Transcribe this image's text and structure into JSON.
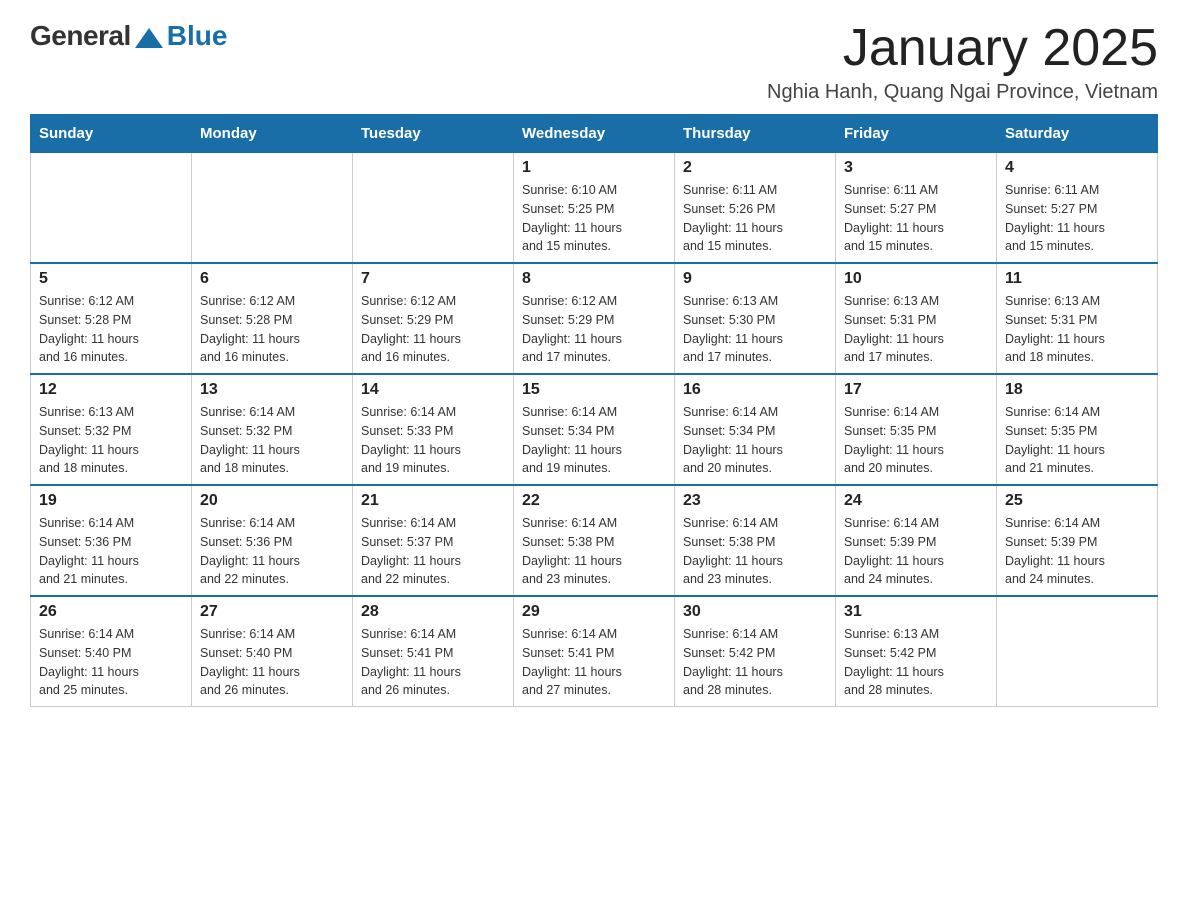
{
  "header": {
    "logo_general": "General",
    "logo_blue": "Blue",
    "month_title": "January 2025",
    "location": "Nghia Hanh, Quang Ngai Province, Vietnam"
  },
  "days_of_week": [
    "Sunday",
    "Monday",
    "Tuesday",
    "Wednesday",
    "Thursday",
    "Friday",
    "Saturday"
  ],
  "weeks": [
    [
      {
        "day": "",
        "info": ""
      },
      {
        "day": "",
        "info": ""
      },
      {
        "day": "",
        "info": ""
      },
      {
        "day": "1",
        "info": "Sunrise: 6:10 AM\nSunset: 5:25 PM\nDaylight: 11 hours\nand 15 minutes."
      },
      {
        "day": "2",
        "info": "Sunrise: 6:11 AM\nSunset: 5:26 PM\nDaylight: 11 hours\nand 15 minutes."
      },
      {
        "day": "3",
        "info": "Sunrise: 6:11 AM\nSunset: 5:27 PM\nDaylight: 11 hours\nand 15 minutes."
      },
      {
        "day": "4",
        "info": "Sunrise: 6:11 AM\nSunset: 5:27 PM\nDaylight: 11 hours\nand 15 minutes."
      }
    ],
    [
      {
        "day": "5",
        "info": "Sunrise: 6:12 AM\nSunset: 5:28 PM\nDaylight: 11 hours\nand 16 minutes."
      },
      {
        "day": "6",
        "info": "Sunrise: 6:12 AM\nSunset: 5:28 PM\nDaylight: 11 hours\nand 16 minutes."
      },
      {
        "day": "7",
        "info": "Sunrise: 6:12 AM\nSunset: 5:29 PM\nDaylight: 11 hours\nand 16 minutes."
      },
      {
        "day": "8",
        "info": "Sunrise: 6:12 AM\nSunset: 5:29 PM\nDaylight: 11 hours\nand 17 minutes."
      },
      {
        "day": "9",
        "info": "Sunrise: 6:13 AM\nSunset: 5:30 PM\nDaylight: 11 hours\nand 17 minutes."
      },
      {
        "day": "10",
        "info": "Sunrise: 6:13 AM\nSunset: 5:31 PM\nDaylight: 11 hours\nand 17 minutes."
      },
      {
        "day": "11",
        "info": "Sunrise: 6:13 AM\nSunset: 5:31 PM\nDaylight: 11 hours\nand 18 minutes."
      }
    ],
    [
      {
        "day": "12",
        "info": "Sunrise: 6:13 AM\nSunset: 5:32 PM\nDaylight: 11 hours\nand 18 minutes."
      },
      {
        "day": "13",
        "info": "Sunrise: 6:14 AM\nSunset: 5:32 PM\nDaylight: 11 hours\nand 18 minutes."
      },
      {
        "day": "14",
        "info": "Sunrise: 6:14 AM\nSunset: 5:33 PM\nDaylight: 11 hours\nand 19 minutes."
      },
      {
        "day": "15",
        "info": "Sunrise: 6:14 AM\nSunset: 5:34 PM\nDaylight: 11 hours\nand 19 minutes."
      },
      {
        "day": "16",
        "info": "Sunrise: 6:14 AM\nSunset: 5:34 PM\nDaylight: 11 hours\nand 20 minutes."
      },
      {
        "day": "17",
        "info": "Sunrise: 6:14 AM\nSunset: 5:35 PM\nDaylight: 11 hours\nand 20 minutes."
      },
      {
        "day": "18",
        "info": "Sunrise: 6:14 AM\nSunset: 5:35 PM\nDaylight: 11 hours\nand 21 minutes."
      }
    ],
    [
      {
        "day": "19",
        "info": "Sunrise: 6:14 AM\nSunset: 5:36 PM\nDaylight: 11 hours\nand 21 minutes."
      },
      {
        "day": "20",
        "info": "Sunrise: 6:14 AM\nSunset: 5:36 PM\nDaylight: 11 hours\nand 22 minutes."
      },
      {
        "day": "21",
        "info": "Sunrise: 6:14 AM\nSunset: 5:37 PM\nDaylight: 11 hours\nand 22 minutes."
      },
      {
        "day": "22",
        "info": "Sunrise: 6:14 AM\nSunset: 5:38 PM\nDaylight: 11 hours\nand 23 minutes."
      },
      {
        "day": "23",
        "info": "Sunrise: 6:14 AM\nSunset: 5:38 PM\nDaylight: 11 hours\nand 23 minutes."
      },
      {
        "day": "24",
        "info": "Sunrise: 6:14 AM\nSunset: 5:39 PM\nDaylight: 11 hours\nand 24 minutes."
      },
      {
        "day": "25",
        "info": "Sunrise: 6:14 AM\nSunset: 5:39 PM\nDaylight: 11 hours\nand 24 minutes."
      }
    ],
    [
      {
        "day": "26",
        "info": "Sunrise: 6:14 AM\nSunset: 5:40 PM\nDaylight: 11 hours\nand 25 minutes."
      },
      {
        "day": "27",
        "info": "Sunrise: 6:14 AM\nSunset: 5:40 PM\nDaylight: 11 hours\nand 26 minutes."
      },
      {
        "day": "28",
        "info": "Sunrise: 6:14 AM\nSunset: 5:41 PM\nDaylight: 11 hours\nand 26 minutes."
      },
      {
        "day": "29",
        "info": "Sunrise: 6:14 AM\nSunset: 5:41 PM\nDaylight: 11 hours\nand 27 minutes."
      },
      {
        "day": "30",
        "info": "Sunrise: 6:14 AM\nSunset: 5:42 PM\nDaylight: 11 hours\nand 28 minutes."
      },
      {
        "day": "31",
        "info": "Sunrise: 6:13 AM\nSunset: 5:42 PM\nDaylight: 11 hours\nand 28 minutes."
      },
      {
        "day": "",
        "info": ""
      }
    ]
  ]
}
